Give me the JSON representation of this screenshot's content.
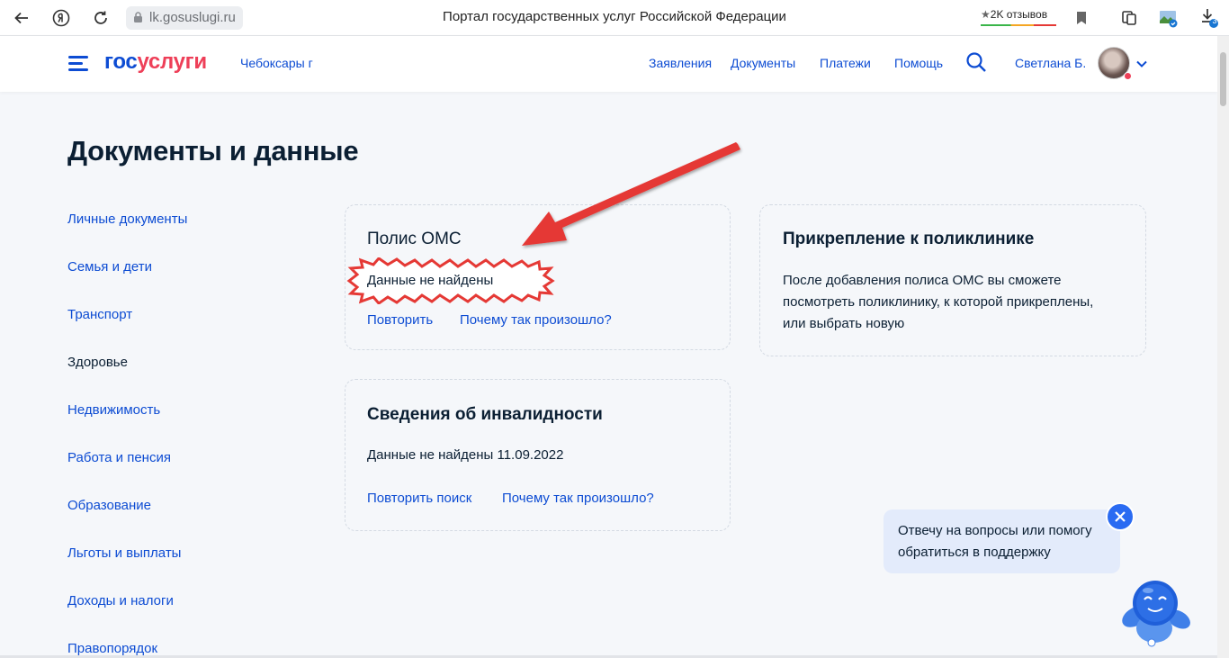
{
  "browser": {
    "url": "lk.gosuslugi.ru",
    "tab_title": "Портал государственных услуг Российской Федерации",
    "reviews": "2K отзывов",
    "downloads_badge": "3"
  },
  "header": {
    "logo_a": "гос",
    "logo_b": "услуги",
    "city": "Чебоксары г",
    "nav": [
      "Заявления",
      "Документы",
      "Платежи",
      "Помощь"
    ],
    "user_name": "Светлана Б."
  },
  "page": {
    "title": "Документы и данные"
  },
  "sidebar": {
    "items": [
      {
        "label": "Личные документы"
      },
      {
        "label": "Семья и дети"
      },
      {
        "label": "Транспорт"
      },
      {
        "label": "Здоровье"
      },
      {
        "label": "Недвижимость"
      },
      {
        "label": "Работа и пенсия"
      },
      {
        "label": "Образование"
      },
      {
        "label": "Льготы и выплаты"
      },
      {
        "label": "Доходы и налоги"
      },
      {
        "label": "Правопорядок"
      }
    ],
    "active_index": 3
  },
  "cards": {
    "oms": {
      "title": "Полис ОМС",
      "status": "Данные не найдены",
      "link_retry": "Повторить",
      "link_why": "Почему так произошло?"
    },
    "clinic": {
      "title": "Прикрепление к поликлинике",
      "text_lines": [
        "После добавления полиса ОМС вы сможете",
        "посмотреть поликлинику, к которой прикреплены,",
        "или выбрать новую"
      ]
    },
    "disability": {
      "title": "Сведения об инвалидности",
      "status": "Данные не найдены 11.09.2022",
      "link_retry": "Повторить поиск",
      "link_why": "Почему так произошло?"
    }
  },
  "chat": {
    "lines": [
      "Отвечу на вопросы или помогу",
      "обратиться в поддержку"
    ]
  },
  "colors": {
    "brand_blue": "#0d4cd3",
    "brand_red": "#ee3f58",
    "annotation_red": "#e53935"
  }
}
